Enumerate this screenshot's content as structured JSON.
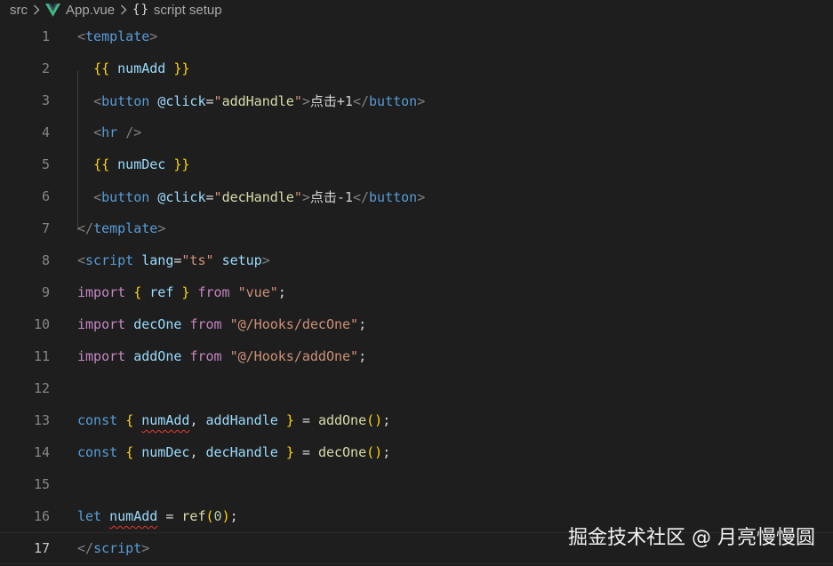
{
  "breadcrumb": {
    "folder": "src",
    "file": "App.vue",
    "symbol": "script setup",
    "symbol_icon": "{}"
  },
  "colors": {
    "background": "#1e1e1e",
    "line_number": "#858585",
    "tag": "#569cd6",
    "attribute": "#9cdcfe",
    "string": "#ce9178",
    "keyword": "#c586c0",
    "function": "#dcdcaa",
    "bracket": "#ffd700",
    "error_squiggle": "#e53935"
  },
  "icons": {
    "vue_file": "vue-logo-icon",
    "chevron": "chevron-right-icon",
    "symbol": "braces-icon"
  },
  "current_line": 17,
  "lines": [
    {
      "n": "1",
      "tokens": [
        [
          "t-punct",
          "<"
        ],
        [
          "t-tag",
          "template"
        ],
        [
          "t-punct",
          ">"
        ]
      ]
    },
    {
      "n": "2",
      "tokens": [
        [
          "t-plain",
          "  "
        ],
        [
          "t-brace",
          "{{"
        ],
        [
          "t-plain",
          " "
        ],
        [
          "t-var",
          "numAdd"
        ],
        [
          "t-plain",
          " "
        ],
        [
          "t-brace",
          "}}"
        ]
      ]
    },
    {
      "n": "3",
      "tokens": [
        [
          "t-plain",
          "  "
        ],
        [
          "t-punct",
          "<"
        ],
        [
          "t-tag",
          "button"
        ],
        [
          "t-plain",
          " "
        ],
        [
          "t-attr",
          "@click"
        ],
        [
          "t-plain",
          "="
        ],
        [
          "t-str",
          "\""
        ],
        [
          "t-fn",
          "addHandle"
        ],
        [
          "t-str",
          "\""
        ],
        [
          "t-punct",
          ">"
        ],
        [
          "t-plain",
          "点击+1"
        ],
        [
          "t-punct",
          "</"
        ],
        [
          "t-tag",
          "button"
        ],
        [
          "t-punct",
          ">"
        ]
      ]
    },
    {
      "n": "4",
      "tokens": [
        [
          "t-plain",
          "  "
        ],
        [
          "t-punct",
          "<"
        ],
        [
          "t-tag",
          "hr"
        ],
        [
          "t-plain",
          " "
        ],
        [
          "t-punct",
          "/>"
        ]
      ]
    },
    {
      "n": "5",
      "tokens": [
        [
          "t-plain",
          "  "
        ],
        [
          "t-brace",
          "{{"
        ],
        [
          "t-plain",
          " "
        ],
        [
          "t-var",
          "numDec"
        ],
        [
          "t-plain",
          " "
        ],
        [
          "t-brace",
          "}}"
        ]
      ]
    },
    {
      "n": "6",
      "tokens": [
        [
          "t-plain",
          "  "
        ],
        [
          "t-punct",
          "<"
        ],
        [
          "t-tag",
          "button"
        ],
        [
          "t-plain",
          " "
        ],
        [
          "t-attr",
          "@click"
        ],
        [
          "t-plain",
          "="
        ],
        [
          "t-str",
          "\""
        ],
        [
          "t-fn",
          "decHandle"
        ],
        [
          "t-str",
          "\""
        ],
        [
          "t-punct",
          ">"
        ],
        [
          "t-plain",
          "点击-1"
        ],
        [
          "t-punct",
          "</"
        ],
        [
          "t-tag",
          "button"
        ],
        [
          "t-punct",
          ">"
        ]
      ]
    },
    {
      "n": "7",
      "tokens": [
        [
          "t-punct",
          "</"
        ],
        [
          "t-tag",
          "template"
        ],
        [
          "t-punct",
          ">"
        ]
      ]
    },
    {
      "n": "8",
      "tokens": [
        [
          "t-punct",
          "<"
        ],
        [
          "t-tag",
          "script"
        ],
        [
          "t-plain",
          " "
        ],
        [
          "t-attr",
          "lang"
        ],
        [
          "t-plain",
          "="
        ],
        [
          "t-str",
          "\"ts\""
        ],
        [
          "t-plain",
          " "
        ],
        [
          "t-attr",
          "setup"
        ],
        [
          "t-punct",
          ">"
        ]
      ]
    },
    {
      "n": "9",
      "tokens": [
        [
          "t-kw",
          "import"
        ],
        [
          "t-plain",
          " "
        ],
        [
          "t-brace",
          "{"
        ],
        [
          "t-plain",
          " "
        ],
        [
          "t-var",
          "ref"
        ],
        [
          "t-plain",
          " "
        ],
        [
          "t-brace",
          "}"
        ],
        [
          "t-plain",
          " "
        ],
        [
          "t-kw",
          "from"
        ],
        [
          "t-plain",
          " "
        ],
        [
          "t-str",
          "\"vue\""
        ],
        [
          "t-plain",
          ";"
        ]
      ]
    },
    {
      "n": "10",
      "tokens": [
        [
          "t-kw",
          "import"
        ],
        [
          "t-plain",
          " "
        ],
        [
          "t-var",
          "decOne"
        ],
        [
          "t-plain",
          " "
        ],
        [
          "t-kw",
          "from"
        ],
        [
          "t-plain",
          " "
        ],
        [
          "t-str",
          "\"@/Hooks/decOne\""
        ],
        [
          "t-plain",
          ";"
        ]
      ]
    },
    {
      "n": "11",
      "tokens": [
        [
          "t-kw",
          "import"
        ],
        [
          "t-plain",
          " "
        ],
        [
          "t-var",
          "addOne"
        ],
        [
          "t-plain",
          " "
        ],
        [
          "t-kw",
          "from"
        ],
        [
          "t-plain",
          " "
        ],
        [
          "t-str",
          "\"@/Hooks/addOne\""
        ],
        [
          "t-plain",
          ";"
        ]
      ]
    },
    {
      "n": "12",
      "tokens": []
    },
    {
      "n": "13",
      "tokens": [
        [
          "t-decl",
          "const"
        ],
        [
          "t-plain",
          " "
        ],
        [
          "t-brace",
          "{"
        ],
        [
          "t-plain",
          " "
        ],
        [
          "t-var squiggle",
          "numAdd"
        ],
        [
          "t-plain",
          ", "
        ],
        [
          "t-var",
          "addHandle"
        ],
        [
          "t-plain",
          " "
        ],
        [
          "t-brace",
          "}"
        ],
        [
          "t-plain",
          " = "
        ],
        [
          "t-fn",
          "addOne"
        ],
        [
          "t-brace",
          "()"
        ],
        [
          "t-plain",
          ";"
        ]
      ]
    },
    {
      "n": "14",
      "tokens": [
        [
          "t-decl",
          "const"
        ],
        [
          "t-plain",
          " "
        ],
        [
          "t-brace",
          "{"
        ],
        [
          "t-plain",
          " "
        ],
        [
          "t-var",
          "numDec"
        ],
        [
          "t-plain",
          ", "
        ],
        [
          "t-var",
          "decHandle"
        ],
        [
          "t-plain",
          " "
        ],
        [
          "t-brace",
          "}"
        ],
        [
          "t-plain",
          " = "
        ],
        [
          "t-fn",
          "decOne"
        ],
        [
          "t-brace",
          "()"
        ],
        [
          "t-plain",
          ";"
        ]
      ]
    },
    {
      "n": "15",
      "tokens": []
    },
    {
      "n": "16",
      "tokens": [
        [
          "t-decl",
          "let"
        ],
        [
          "t-plain",
          " "
        ],
        [
          "t-var squiggle",
          "numAdd"
        ],
        [
          "t-plain",
          " = "
        ],
        [
          "t-fn",
          "ref"
        ],
        [
          "t-brace",
          "("
        ],
        [
          "t-num",
          "0"
        ],
        [
          "t-brace",
          ")"
        ],
        [
          "t-plain",
          ";"
        ]
      ]
    },
    {
      "n": "17",
      "tokens": [
        [
          "t-punct",
          "</"
        ],
        [
          "t-tag",
          "script"
        ],
        [
          "t-punct",
          ">"
        ]
      ]
    }
  ],
  "watermark": "掘金技术社区 @ 月亮慢慢圆"
}
